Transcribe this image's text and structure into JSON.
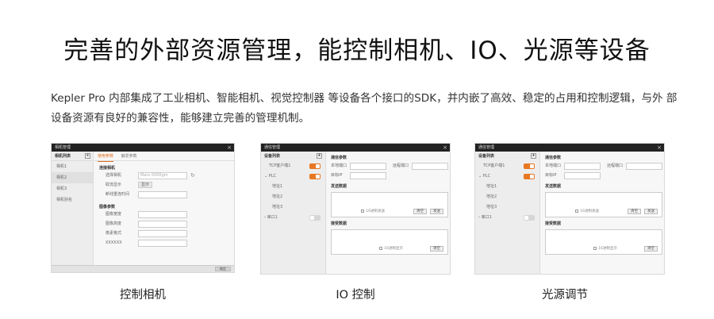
{
  "headline": "完善的外部资源管理，能控制相机、IO、光源等设备",
  "description": "Kepler Pro 内部集成了工业相机、智能相机、视觉控制器 等设备各个接口的SDK，并内嵌了高效、稳定的占用和控制逻辑，与外 部设备资源有良好的兼容性，能够建立完善的管理机制。",
  "screens": [
    {
      "caption": "控制相机",
      "title": "相机管理",
      "list_header": "相机列表",
      "items": [
        "相机1",
        "相机2",
        "相机3",
        "相机别名"
      ],
      "tabs": [
        "使用参数",
        "触发参数"
      ],
      "section1": "连接相机",
      "rows1": [
        {
          "label": "选择相机",
          "value": "Mars-5000gm"
        },
        {
          "label": "取流显示",
          "value": "显示"
        },
        {
          "label": "断线重连时间",
          "value": ""
        }
      ],
      "section2": "图像参数",
      "rows2": [
        {
          "label": "图像宽度"
        },
        {
          "label": "图像高度"
        },
        {
          "label": "像素格式"
        },
        {
          "label": "XXXXXX"
        }
      ],
      "ok_label": "确定"
    },
    {
      "caption": "IO 控制",
      "title": "通信管理",
      "list_header": "设备列表",
      "tree": [
        {
          "label": "TCP客户端1",
          "level": "l1",
          "toggle": "on"
        },
        {
          "label": "PLC",
          "level": "l1",
          "arrow": "⌄",
          "toggle": "on"
        },
        {
          "label": "地址1",
          "level": "l2"
        },
        {
          "label": "地址2",
          "level": "l2"
        },
        {
          "label": "地址3",
          "level": "l2"
        },
        {
          "label": "串口1",
          "level": "l1",
          "arrow": "›",
          "toggle": "off"
        }
      ],
      "comm_params": "通信参数",
      "local_port": "本地端口",
      "remote_port": "远程端口",
      "target_ip": "目标IP",
      "send_data": "发送数据",
      "hex_send": "16进制发送",
      "clear": "清空",
      "send": "发送",
      "recv_data": "接受数据",
      "hex_show": "16进制显示"
    },
    {
      "caption": "光源调节",
      "title": "通信管理",
      "list_header": "设备列表",
      "tree": [
        {
          "label": "TCP客户端1",
          "level": "l1",
          "toggle": "on"
        },
        {
          "label": "PLC",
          "level": "l1",
          "arrow": "⌄",
          "toggle": "on"
        },
        {
          "label": "地址1",
          "level": "l2"
        },
        {
          "label": "地址2",
          "level": "l2"
        },
        {
          "label": "地址3",
          "level": "l2"
        },
        {
          "label": "串口1",
          "level": "l1",
          "arrow": "›",
          "toggle": "off"
        }
      ],
      "comm_params": "通信参数",
      "local_port": "本地端口",
      "remote_port": "远程端口",
      "target_ip": "目标IP",
      "send_data": "发送数据",
      "hex_send": "16进制发送",
      "clear": "清空",
      "send": "发送",
      "recv_data": "接受数据",
      "hex_show": "16进制显示"
    }
  ]
}
